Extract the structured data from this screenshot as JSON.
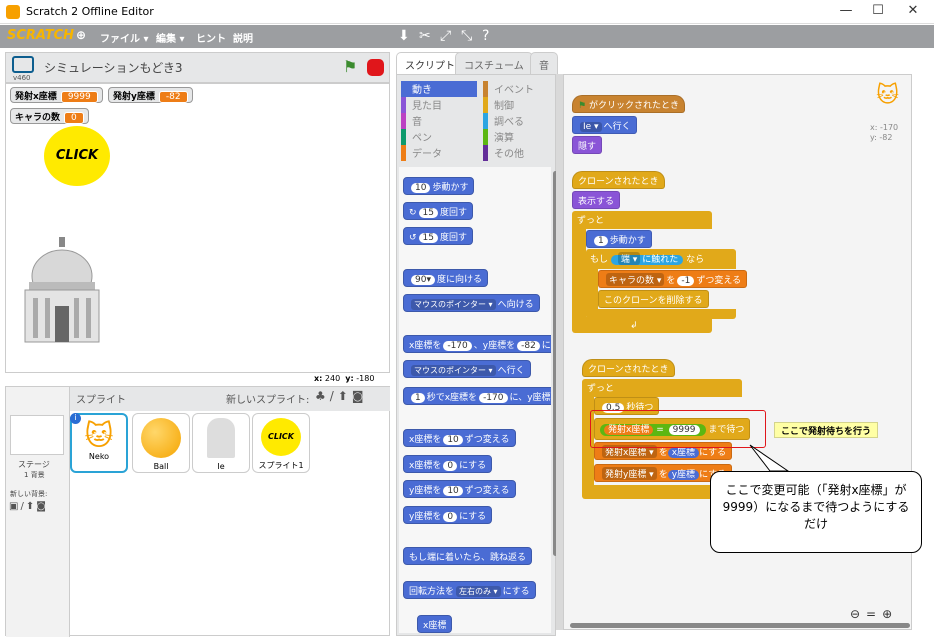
{
  "window": {
    "title": "Scratch 2 Offline Editor",
    "min": "—",
    "max": "☐",
    "close": "✕"
  },
  "menu": {
    "logo": "SCRATCH",
    "file": "ファイル ▾",
    "edit": "編集 ▾",
    "hint": "ヒント",
    "about": "説明"
  },
  "stage": {
    "version": "v460",
    "project_title": "シミュレーションもどき3",
    "monitors": [
      {
        "label": "発射x座標",
        "value": "9999"
      },
      {
        "label": "発射y座標",
        "value": "-82"
      },
      {
        "label": "キャラの数",
        "value": "0"
      }
    ],
    "click_text": "CLICK",
    "coords": {
      "x_label": "x:",
      "x": "240",
      "y_label": "y:",
      "y": "-180"
    }
  },
  "sprites": {
    "header": "スプライト",
    "new_sprite": "新しいスプライト:",
    "stage_label": "ステージ",
    "stage_bg_count": "1 背景",
    "new_backdrop": "新しい背景:",
    "items": [
      {
        "name": "Neko"
      },
      {
        "name": "Ball"
      },
      {
        "name": "Ie"
      },
      {
        "name": "スプライト1"
      }
    ],
    "click_text": "CLICK"
  },
  "tabs": [
    "スクリプト",
    "コスチューム",
    "音"
  ],
  "palette": {
    "categories_left": [
      {
        "label": "動き",
        "color": "#4a6cd4"
      },
      {
        "label": "見た目",
        "color": "#8a55d7"
      },
      {
        "label": "音",
        "color": "#bb42c3"
      },
      {
        "label": "ペン",
        "color": "#0e9a6c"
      },
      {
        "label": "データ",
        "color": "#ee7d16"
      }
    ],
    "categories_right": [
      {
        "label": "イベント",
        "color": "#c88330"
      },
      {
        "label": "制御",
        "color": "#e1a91a"
      },
      {
        "label": "調べる",
        "color": "#2ca5e2"
      },
      {
        "label": "演算",
        "color": "#5cb712"
      },
      {
        "label": "その他",
        "color": "#632d99"
      }
    ],
    "blocks": {
      "move_v": "10",
      "move_t": "歩動かす",
      "turn_r_v": "15",
      "turn_r_t": "度回す",
      "turn_l_v": "15",
      "turn_l_t": "度回す",
      "point_v": "90▾",
      "point_t": "度に向ける",
      "point_to_dd": "マウスのポインター ▾",
      "point_to_t": "へ向ける",
      "goto_xy_a": "x座標を",
      "goto_xy_x": "-170",
      "goto_xy_b": "、y座標を",
      "goto_xy_y": "-82",
      "goto_xy_c": "にす",
      "goto_dd": "マウスのポインター ▾",
      "goto_t": "へ行く",
      "glide_v": "1",
      "glide_a": "秒でx座標を",
      "glide_x": "-170",
      "glide_b": "に、y座標を",
      "chx_a": "x座標を",
      "chx_v": "10",
      "chx_b": "ずつ変える",
      "setx_a": "x座標を",
      "setx_v": "0",
      "setx_b": "にする",
      "chy_a": "y座標を",
      "chy_v": "10",
      "chy_b": "ずつ変える",
      "sety_a": "y座標を",
      "sety_v": "0",
      "sety_b": "にする",
      "bounce": "もし端に着いたら、跳ね返る",
      "rot_a": "回転方法を",
      "rot_dd": "左右のみ ▾",
      "rot_b": "にする",
      "xpos": "x座標"
    }
  },
  "scripts": {
    "s1": {
      "hat": "がクリックされたとき",
      "goto_dd": "Ie ▾",
      "goto_t": "へ行く",
      "hide": "隠す"
    },
    "s2": {
      "hat": "クローンされたとき",
      "show": "表示する",
      "forever": "ずっと",
      "move_v": "1",
      "move_t": "歩動かす",
      "if_a": "もし",
      "if_dd": "端 ▾",
      "if_b": "に触れた",
      "if_c": "なら",
      "chg_dd": "キャラの数 ▾",
      "chg_a": "を",
      "chg_v": "-1",
      "chg_b": "ずつ変える",
      "del": "このクローンを削除する"
    },
    "s3": {
      "hat": "クローンされたとき",
      "forever": "ずっと",
      "wait_v": "0.5",
      "wait_t": "秒待つ",
      "wu_var": "発射x座標",
      "wu_eq": "=",
      "wu_v": "9999",
      "wu_t": "まで待つ",
      "setx_dd": "発射x座標 ▾",
      "setx_a": "を",
      "setx_v": "x座標",
      "setx_b": "にする",
      "sety_dd": "発射y座標 ▾",
      "sety_a": "を",
      "sety_v": "y座標",
      "sety_b": "にする"
    },
    "note": "ここで発射待ちを行う",
    "callout": "ここで変更可能（「発射x座標」が9999）になるまで待つようにするだけ",
    "sprite_xy": {
      "x": "x: -170",
      "y": "y: -82"
    }
  }
}
